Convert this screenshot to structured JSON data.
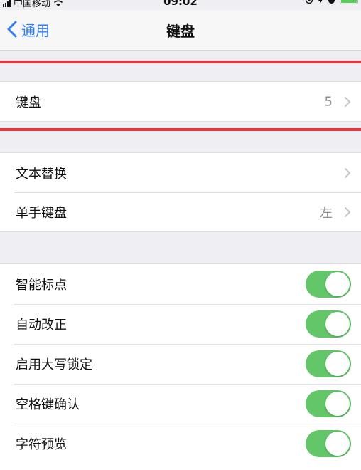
{
  "status_bar": {
    "carrier": "中国移动",
    "time": "09:02"
  },
  "nav": {
    "back_label": "通用",
    "title": "键盘"
  },
  "groups": {
    "keyboards": {
      "label": "键盘",
      "detail": "5"
    },
    "text_replacement": {
      "label": "文本替换"
    },
    "one_handed": {
      "label": "单手键盘",
      "detail": "左"
    }
  },
  "toggles": [
    {
      "label": "智能标点",
      "on": true
    },
    {
      "label": "自动改正",
      "on": true
    },
    {
      "label": "启用大写锁定",
      "on": true
    },
    {
      "label": "空格键确认",
      "on": true
    },
    {
      "label": "字符预览",
      "on": true
    }
  ],
  "colors": {
    "accent": "#2f7cf6",
    "toggle_on": "#63c76a",
    "highlight": "#e0383d",
    "background": "#eeeef3"
  }
}
